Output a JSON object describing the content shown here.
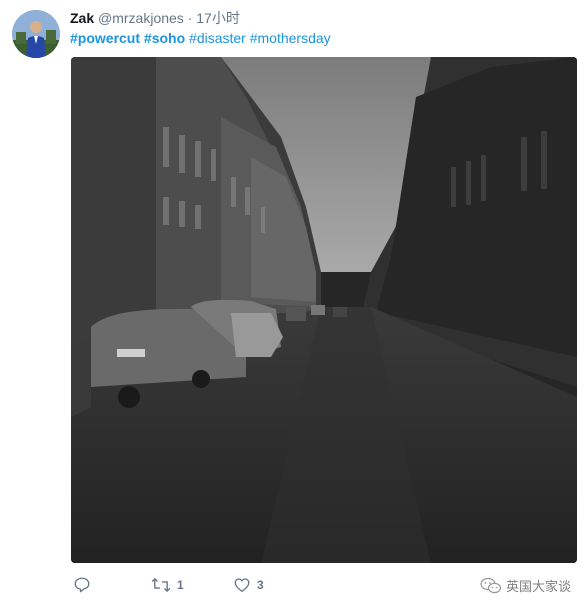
{
  "tweet": {
    "author_name": "Zak",
    "author_handle": "@mrzakjones",
    "separator": "·",
    "timestamp": "17小时",
    "hashtags": [
      "#powercut",
      "#soho",
      "#disaster",
      "#mothersday"
    ],
    "actions": {
      "reply_count": "",
      "retweet_count": "1",
      "like_count": "3"
    }
  },
  "watermark": {
    "text": "英国大家谈"
  },
  "colors": {
    "link": "#1b95e0",
    "muted": "#657786",
    "text": "#14171a"
  },
  "icons": {
    "reply": "reply-icon",
    "retweet": "retweet-icon",
    "like": "heart-icon",
    "watermark": "wechat-icon"
  }
}
